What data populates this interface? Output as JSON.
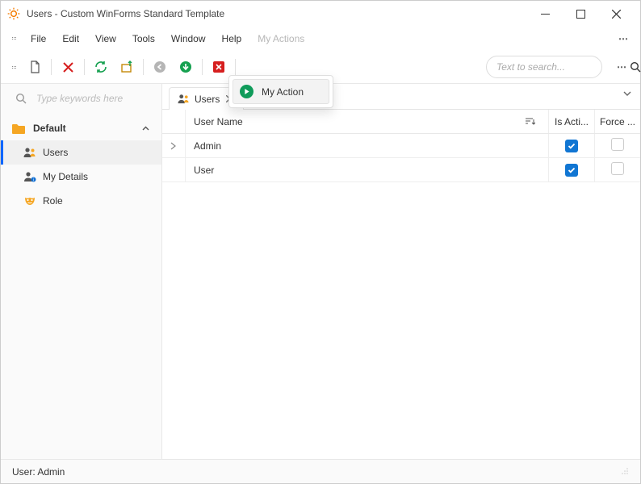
{
  "window": {
    "title": "Users - Custom WinForms Standard Template"
  },
  "menu": {
    "items": [
      "File",
      "Edit",
      "View",
      "Tools",
      "Window",
      "Help",
      "My Actions"
    ]
  },
  "dropdown": {
    "action_label": "My Action"
  },
  "search": {
    "placeholder": "Text to search..."
  },
  "sidebar": {
    "filter_placeholder": "Type keywords here",
    "group": "Default",
    "items": [
      {
        "label": "Users"
      },
      {
        "label": "My Details"
      },
      {
        "label": "Role"
      }
    ]
  },
  "tab": {
    "label": "Users"
  },
  "grid": {
    "columns": {
      "name": "User Name",
      "active": "Is Acti...",
      "force": "Force ..."
    },
    "rows": [
      {
        "name": "Admin",
        "active": true,
        "force": false,
        "current": true
      },
      {
        "name": "User",
        "active": true,
        "force": false,
        "current": false
      }
    ]
  },
  "status": {
    "user": "User: Admin"
  }
}
